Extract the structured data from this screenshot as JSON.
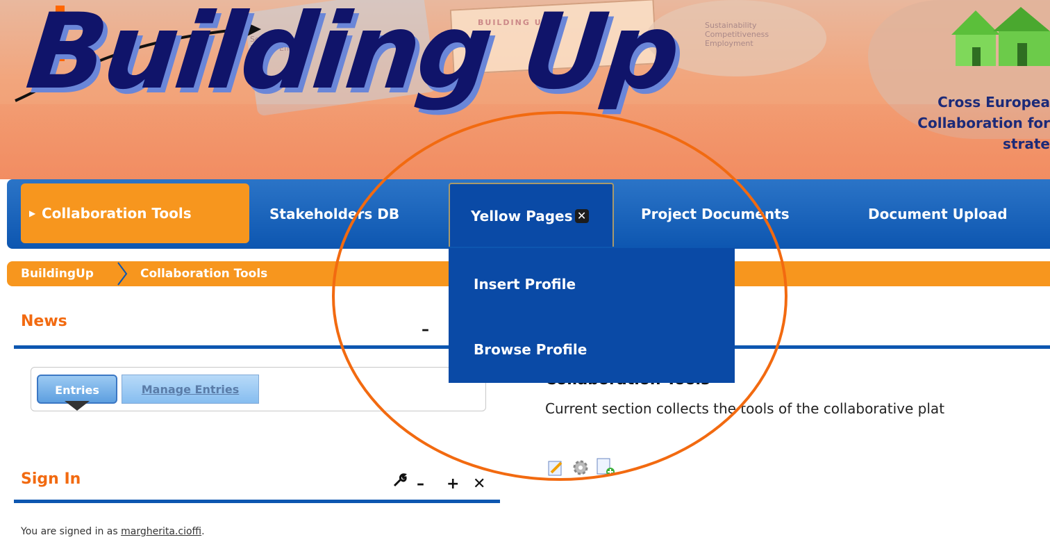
{
  "banner": {
    "logo_text": "Building Up",
    "tagline_lines": [
      "Cross Europea",
      "Collaboration for",
      "strate"
    ],
    "decor_text": {
      "doc_title": "BUILDING UP",
      "note1": "Solutions for\nEnergy Effic",
      "note2": "Sustainability\nCompetitiveness\nEmployment"
    }
  },
  "nav": {
    "items": [
      {
        "label": "Collaboration Tools",
        "state": "active"
      },
      {
        "label": "Stakeholders DB",
        "state": "normal"
      },
      {
        "label": "Yellow Pages",
        "state": "open"
      },
      {
        "label": "Project Documents",
        "state": "normal"
      },
      {
        "label": "Document Upload",
        "state": "normal"
      }
    ],
    "close_glyph": "✕",
    "dropdown": [
      "Insert Profile",
      "Browse Profile"
    ]
  },
  "breadcrumb": [
    "BuildingUp",
    "Collaboration Tools"
  ],
  "news": {
    "title": "News",
    "minimize": "–",
    "tabs": {
      "entries": "Entries",
      "manage": "Manage Entries"
    }
  },
  "content": {
    "heading": "Collaboration Tools",
    "text": "Current section collects the tools of the collaborative plat",
    "icons": [
      "edit-icon",
      "gear-icon",
      "add-page-icon"
    ]
  },
  "signin": {
    "title": "Sign In",
    "controls": {
      "wrench": "🔧",
      "minimize": "–",
      "maximize": "+",
      "close": "✕"
    },
    "signed_prefix": "You are signed in as ",
    "username": "margherita.cioffi",
    "signed_suffix": "."
  },
  "colors": {
    "nav_blue": "#0d56b0",
    "accent_orange": "#f7961e",
    "title_orange": "#f26a10",
    "logo_navy": "#10146a"
  }
}
